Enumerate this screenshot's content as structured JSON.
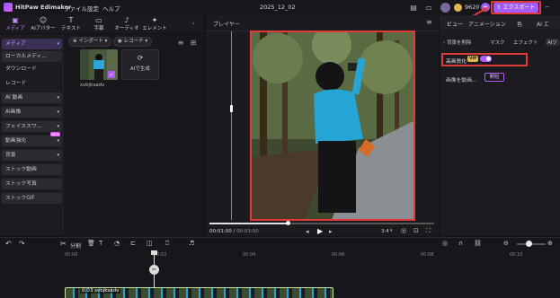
{
  "app": {
    "title": "HitPaw Edimakor"
  },
  "menu": [
    "ファイル",
    "設定",
    "ヘルプ"
  ],
  "project_name": "2025_12_02",
  "coins": "9620",
  "export_label": "エクスポート",
  "toolbar": [
    {
      "label": "メディア",
      "icon": "media-icon",
      "glyph": "▣",
      "active": true
    },
    {
      "label": "AIアバター",
      "icon": "avatar-icon",
      "glyph": "☺",
      "active": false
    },
    {
      "label": "テキスト",
      "icon": "text-icon",
      "glyph": "T",
      "active": false
    },
    {
      "label": "字幕",
      "icon": "subtitle-icon",
      "glyph": "▭",
      "active": false
    },
    {
      "label": "オーディオ",
      "icon": "audio-icon",
      "glyph": "♪",
      "active": false
    },
    {
      "label": "エレメント",
      "icon": "element-icon",
      "glyph": "✦",
      "active": false
    }
  ],
  "sidenav": [
    {
      "label": "メディア",
      "active": true,
      "btn": false,
      "arrow": true
    },
    {
      "label": "ローカルメディ...",
      "active": false,
      "btn": true,
      "arrow": false
    },
    {
      "label": "ダウンロード",
      "active": false,
      "btn": false,
      "arrow": false
    },
    {
      "label": "レコード",
      "active": false,
      "btn": false,
      "arrow": false
    },
    {
      "label": "AI 動画",
      "active": false,
      "btn": true,
      "arrow": true
    },
    {
      "label": "AI画像",
      "active": false,
      "btn": true,
      "arrow": true
    },
    {
      "label": "フェイススワ...",
      "active": false,
      "btn": true,
      "arrow": true
    },
    {
      "label": "動画強化",
      "active": false,
      "btn": true,
      "arrow": true,
      "badge": "NEW"
    },
    {
      "label": "背景",
      "active": false,
      "btn": true,
      "arrow": true
    },
    {
      "label": "ストック動画",
      "active": false,
      "btn": true,
      "arrow": false
    },
    {
      "label": "ストック写真",
      "active": false,
      "btn": true,
      "arrow": false
    },
    {
      "label": "ストックGIF",
      "active": false,
      "btn": true,
      "arrow": false
    }
  ],
  "media": {
    "import_label": "インポート",
    "record_label": "レコード",
    "clip_name": "svbjksadv",
    "ai_generate": "AIで生成"
  },
  "player": {
    "title": "プレイヤー",
    "time_current": "00:01:00",
    "time_total": "00:03:00",
    "aspect": "3:4",
    "progress": 0.35
  },
  "right_panel": {
    "tabs": [
      "ビュー",
      "アニメーション",
      "色",
      "AI エ"
    ],
    "subtabs": [
      "背景を削除",
      "マスク",
      "エフェクト",
      "AIツ"
    ],
    "hd_label": "高画質化",
    "vip": "VIP",
    "image_to_video_label": "画像を動画...",
    "start_label": "開始"
  },
  "timeline": {
    "split_label": "分割",
    "ruler": [
      "00:00",
      "00:02",
      "00:04",
      "00:06",
      "00:08",
      "00:10"
    ],
    "clip_label": "0:03 svbjksadv"
  },
  "colors": {
    "accent": "#b25cff",
    "highlight": "#e03b3b"
  }
}
